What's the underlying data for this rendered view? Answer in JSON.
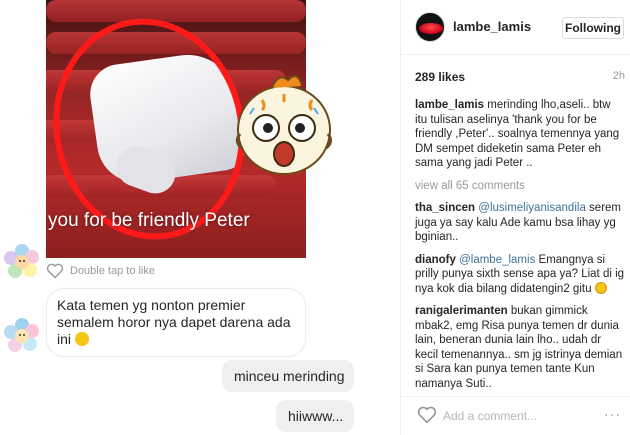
{
  "chat": {
    "photo_caption": "you for be friendly Peter",
    "double_tap_hint": "Double tap to like",
    "incoming_message": "Kata temen yg nonton premier semalem horor nya dapet darena ada ini",
    "outgoing_1": "minceu merinding",
    "outgoing_2": "hiiwww..."
  },
  "post": {
    "username": "lambe_lamis",
    "follow_label": "Following",
    "likes": "289 likes",
    "time": "2h",
    "caption_user": "lambe_lamis",
    "caption_text": "merinding lho,aseli.. btw itu tulisan aselinya 'thank you for be friendly ,Peter'.. soalnya temennya yang DM sempet dideketin sama Peter eh sama yang jadi Peter ..",
    "view_all": "view all 65 comments",
    "comments": [
      {
        "user": "tha_sincen",
        "tag": "@lusimeliyanisandila",
        "text": "serem juga ya say kalu Ade kamu bsa lihay yg bginian.."
      },
      {
        "user": "dianofy",
        "tag": "@lambe_lamis",
        "text": "Emangnya si prilly punya sixth sense apa ya? Liat di ig nya kok dia bilang didatengin2 gitu"
      },
      {
        "user": "ranigalerimanten",
        "tag": "",
        "text": "bukan gimmick mbak2, emg Risa punya temen dr dunia lain, beneran dunia lain lho.. udah dr kecil temenannya.. sm jg istrinya demian si Sara kan punya temen tante Kun namanya Suti.."
      }
    ],
    "add_comment_placeholder": "Add a comment...",
    "more_label": "···"
  },
  "colors": {
    "link": "#3f729b",
    "muted": "#999999",
    "border": "#efefef",
    "seat_red": "#b32a2a",
    "circle_red": "#ff1a1a"
  },
  "icons": [
    "heart-icon",
    "flower-avatar-icon",
    "lips-avatar-icon",
    "sticker-icon",
    "emoji-icon",
    "more-icon"
  ]
}
